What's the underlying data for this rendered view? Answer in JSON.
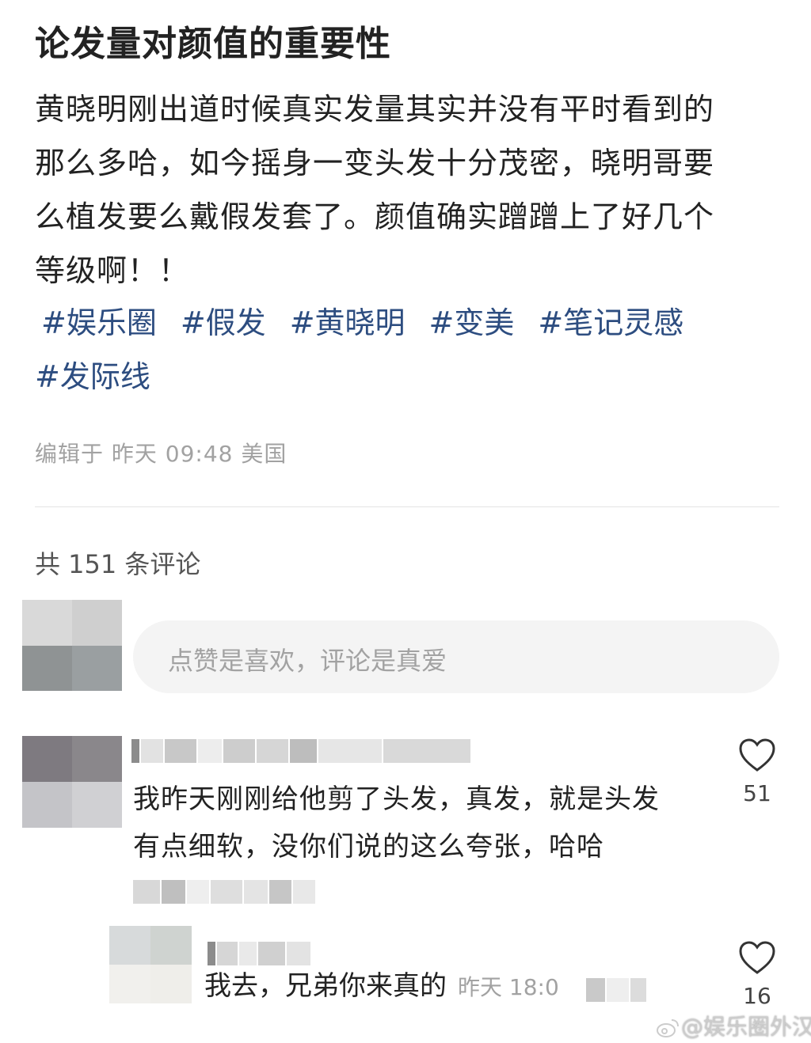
{
  "post": {
    "title": "论发量对颜值的重要性",
    "body_lines": [
      "黄晓明刚出道时候真实发量其实并没有平时看到的",
      "那么多哈，如今摇身一变头发十分茂密，晓明哥要",
      "么植发要么戴假发套了。颜值确实蹭蹭上了好几个",
      "等级啊！！"
    ],
    "tags": [
      "#娱乐圈",
      "#假发",
      "#黄晓明",
      "#变美",
      "#笔记灵感",
      "#发际线"
    ],
    "meta": "编辑于 昨天 09:48 美国"
  },
  "comments": {
    "count_label": "共 151 条评论",
    "input_placeholder": "点赞是喜欢，评论是真爱",
    "items": [
      {
        "text_lines": [
          "我昨天刚刚给他剪了头发，真发，就是头发",
          "有点细软，没你们说的这么夸张，哈哈"
        ],
        "likes": "51"
      }
    ],
    "reply": {
      "text": "我去，兄弟你来真的",
      "time": "昨天 18:0",
      "likes": "16"
    }
  },
  "watermark": "@娱乐圈外汉",
  "icons": {
    "like": "heart-outline-icon",
    "brand": "weibo-logo-icon"
  },
  "colors": {
    "tag": "#2d4d80",
    "meta": "#a2a2a2",
    "text": "#222222"
  }
}
